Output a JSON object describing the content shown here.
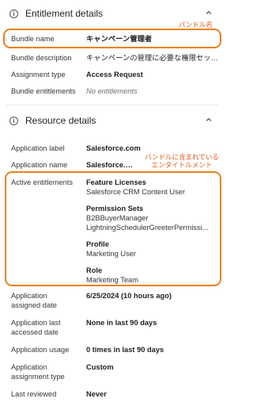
{
  "entitlement_details": {
    "title": "Entitlement details",
    "rows": [
      {
        "label": "Bundle name",
        "value": "キャンペーン管理者"
      },
      {
        "label": "Bundle description",
        "value": "キャンペーンの管理に必要な権限セッ…"
      },
      {
        "label": "Assignment type",
        "value": "Access Request"
      },
      {
        "label": "Bundle entitlements",
        "value": "No entitlements"
      }
    ]
  },
  "resource_details": {
    "title": "Resource details",
    "application_label": {
      "label": "Application label",
      "value": "Salesforce.com"
    },
    "application_name": {
      "label": "Application name",
      "value": "Salesforce.com"
    },
    "active_entitlements": {
      "label": "Active entitlements",
      "groups": [
        {
          "title": "Feature Licenses",
          "items": [
            "Salesforce CRM Content User"
          ]
        },
        {
          "title": "Permission Sets",
          "items": [
            "B2BBuyerManager",
            "LightningSchedulerGreeterPermissi..."
          ]
        },
        {
          "title": "Profile",
          "items": [
            "Marketing User"
          ]
        },
        {
          "title": "Role",
          "items": [
            "Marketing Team"
          ]
        }
      ]
    },
    "rows_after": [
      {
        "label": "Application assigned date",
        "value": "6/25/2024 (10 hours ago)"
      },
      {
        "label": "Application last accessed date",
        "value": "None in last 90 days"
      },
      {
        "label": "Application usage",
        "value": "0 times in last 90 days"
      },
      {
        "label": "Application assignment type",
        "value": "Custom"
      },
      {
        "label": "Last reviewed",
        "value": "Never"
      }
    ]
  },
  "annotations": {
    "bundle_name": "バンドル名",
    "entitlements": "バンドルに含まれている\nエンタイトルメント"
  },
  "icons": {
    "section": "info-icon",
    "collapse": "chevron-up-icon"
  },
  "colors": {
    "callout": "#e9821e",
    "annotation_text": "#e35a16"
  }
}
